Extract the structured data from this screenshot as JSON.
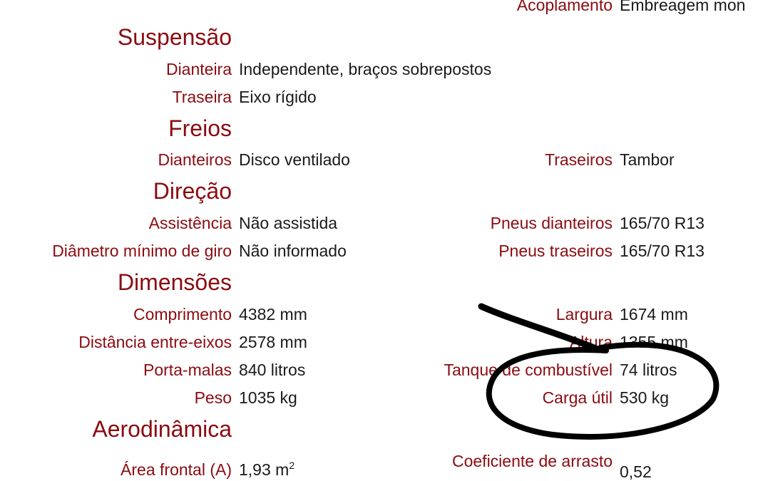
{
  "rows": {
    "acoplamento": {
      "label": "Acoplamento",
      "value": "Embreagem mon"
    },
    "suspensao": {
      "title": "Suspensão",
      "dianteira_label": "Dianteira",
      "dianteira_value": "Independente, braços sobrepostos",
      "traseira_label": "Traseira",
      "traseira_value": "Eixo rígido"
    },
    "freios": {
      "title": "Freios",
      "dianteiros_label": "Dianteiros",
      "dianteiros_value": "Disco ventilado",
      "traseiros_label": "Traseiros",
      "traseiros_value": "Tambor"
    },
    "direcao": {
      "title": "Direção",
      "assistencia_label": "Assistência",
      "assistencia_value": "Não assistida",
      "pneus_d_label": "Pneus dianteiros",
      "pneus_d_value": "165/70 R13",
      "giro_label": "Diâmetro mínimo de giro",
      "giro_value": "Não informado",
      "pneus_t_label": "Pneus traseiros",
      "pneus_t_value": "165/70 R13"
    },
    "dimensoes": {
      "title": "Dimensões",
      "comprimento_label": "Comprimento",
      "comprimento_value": "4382 mm",
      "largura_label": "Largura",
      "largura_value": "1674 mm",
      "entre_eixos_label": "Distância entre-eixos",
      "entre_eixos_value": "2578 mm",
      "altura_label": "Altura",
      "altura_value": "1355 mm",
      "porta_malas_label": "Porta-malas",
      "porta_malas_value": "840 litros",
      "tanque_label": "Tanque de combustível",
      "tanque_value": "74 litros",
      "peso_label": "Peso",
      "peso_value": "1035 kg",
      "carga_label": "Carga útil",
      "carga_value": "530 kg"
    },
    "aerodinamica": {
      "title": "Aerodinâmica",
      "area_label": "Área frontal (A)",
      "area_value": "1,93 m",
      "area_unit_sup": "2",
      "cx_label": "Coeficiente de arrasto",
      "cx_value": "0,52"
    }
  },
  "annotation": {
    "color": "#000000"
  }
}
